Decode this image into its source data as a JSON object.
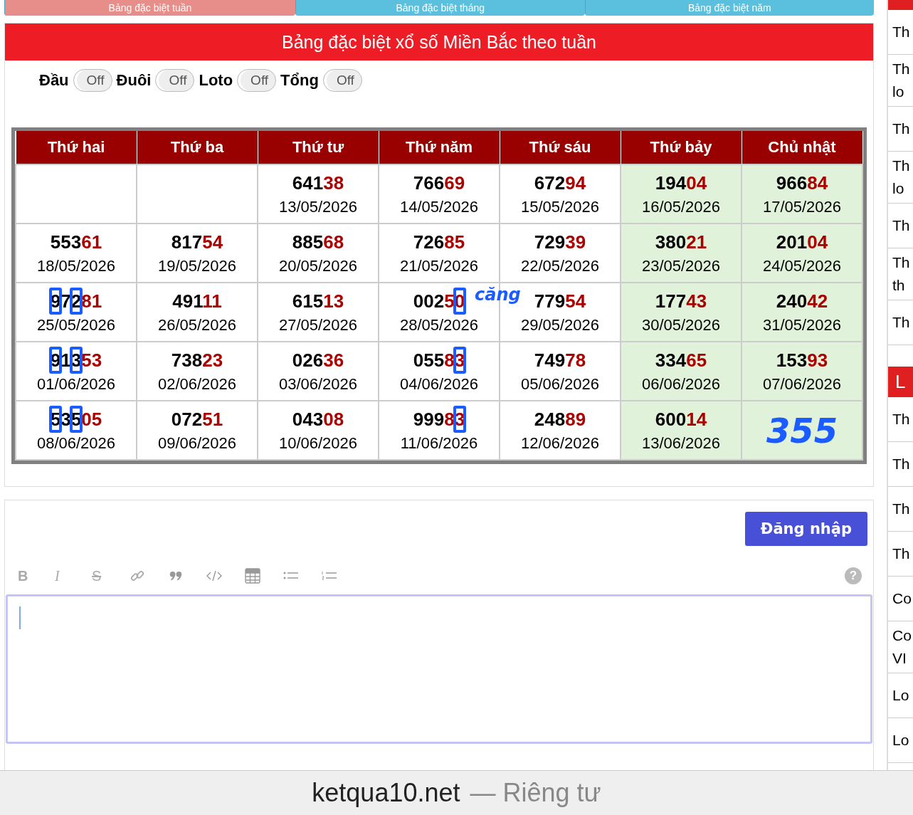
{
  "tabs": [
    {
      "label": "Bảng đặc biệt tuần",
      "selected": true
    },
    {
      "label": "Bảng đặc biệt tháng",
      "selected": false
    },
    {
      "label": "Bảng đặc biệt năm",
      "selected": false
    }
  ],
  "panel": {
    "title": "Bảng đặc biệt xổ số Miền Bắc theo tuần",
    "toggles": [
      {
        "label": "Đầu",
        "state": "Off",
        "on": false
      },
      {
        "label": "Đuôi",
        "state": "Off",
        "on": false
      },
      {
        "label": "Loto",
        "state": "Off",
        "on": false
      },
      {
        "label": "Tổng",
        "state": "Off",
        "on": false
      }
    ],
    "table": {
      "columns": [
        {
          "label": "Thứ hai",
          "weekend": false
        },
        {
          "label": "Thứ ba",
          "weekend": false
        },
        {
          "label": "Thứ tư",
          "weekend": false
        },
        {
          "label": "Thứ năm",
          "weekend": false
        },
        {
          "label": "Thứ sáu",
          "weekend": false
        },
        {
          "label": "Thứ bảy",
          "weekend": true
        },
        {
          "label": "Chủ nhật",
          "weekend": true
        }
      ],
      "rows": [
        [
          {},
          {},
          {
            "number": "64138",
            "date": "13/05/2026"
          },
          {
            "number": "76669",
            "date": "14/05/2026"
          },
          {
            "number": "67294",
            "date": "15/05/2026"
          },
          {
            "number": "19404",
            "date": "16/05/2026"
          },
          {
            "number": "96684",
            "date": "17/05/2026"
          }
        ],
        [
          {
            "number": "55361",
            "date": "18/05/2026"
          },
          {
            "number": "81754",
            "date": "19/05/2026"
          },
          {
            "number": "88568",
            "date": "20/05/2026"
          },
          {
            "number": "72685",
            "date": "21/05/2026"
          },
          {
            "number": "72939",
            "date": "22/05/2026"
          },
          {
            "number": "38021",
            "date": "23/05/2026"
          },
          {
            "number": "20104",
            "date": "24/05/2026"
          }
        ],
        [
          {
            "number": "97281",
            "date": "25/05/2026",
            "front_marked": true
          },
          {
            "number": "49111",
            "date": "26/05/2026"
          },
          {
            "number": "61513",
            "date": "27/05/2026"
          },
          {
            "number": "00250",
            "date": "28/05/2026",
            "last_marked": true
          },
          {
            "number": "77954",
            "date": "29/05/2026",
            "note": "căng"
          },
          {
            "number": "17743",
            "date": "30/05/2026"
          },
          {
            "number": "24042",
            "date": "31/05/2026"
          }
        ],
        [
          {
            "number": "91353",
            "date": "01/06/2026",
            "front_marked": true
          },
          {
            "number": "73823",
            "date": "02/06/2026"
          },
          {
            "number": "02636",
            "date": "03/06/2026"
          },
          {
            "number": "05583",
            "date": "04/06/2026",
            "last_marked": true
          },
          {
            "number": "74978",
            "date": "05/06/2026"
          },
          {
            "number": "33465",
            "date": "06/06/2026"
          },
          {
            "number": "15393",
            "date": "07/06/2026"
          }
        ],
        [
          {
            "number": "53505",
            "date": "08/06/2026",
            "front_marked": true
          },
          {
            "number": "07251",
            "date": "09/06/2026"
          },
          {
            "number": "04308",
            "date": "10/06/2026"
          },
          {
            "number": "99983",
            "date": "11/06/2026",
            "last_marked": true
          },
          {
            "number": "24889",
            "date": "12/06/2026"
          },
          {
            "number": "60014",
            "date": "13/06/2026"
          },
          {
            "note": "355"
          }
        ]
      ]
    }
  },
  "editor": {
    "login_button": "Đăng nhập",
    "toolbar": [
      {
        "kind": "bold",
        "glyph": "B"
      },
      {
        "kind": "italic",
        "glyph": "I"
      },
      {
        "kind": "strike",
        "glyph": "S"
      },
      {
        "kind": "link"
      },
      {
        "kind": "quote"
      },
      {
        "kind": "code"
      },
      {
        "kind": "table"
      },
      {
        "kind": "bullets"
      },
      {
        "kind": "numbers"
      },
      {
        "kind": "help",
        "glyph": "?"
      }
    ]
  },
  "sidebar": {
    "groups": [
      {
        "items": [
          "Th",
          "Th lo",
          "Th",
          "Th lo",
          "Th",
          "Th th",
          "Th"
        ]
      },
      {
        "header": "L",
        "items": [
          "Th",
          "Th",
          "Th",
          "Th",
          "Co",
          "Co VI",
          "Lo",
          "Lo"
        ]
      }
    ]
  },
  "status_bar": {
    "domain": "ketqua10.net",
    "label": "— Riêng tư"
  }
}
